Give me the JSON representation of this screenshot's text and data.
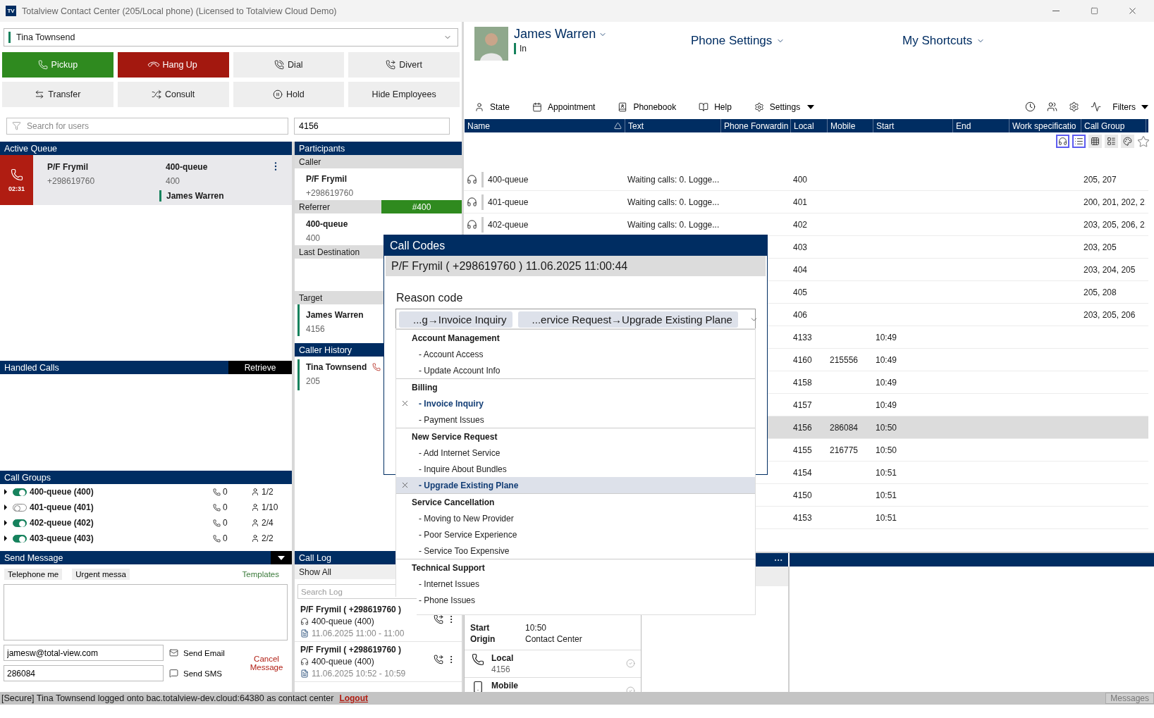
{
  "window": {
    "logo": "TV",
    "title": "Totalview Contact Center (205/Local phone) (Licensed to Totalview Cloud Demo)"
  },
  "user_select": {
    "value": "Tina Townsend"
  },
  "call_buttons": [
    {
      "label": "Pickup",
      "kind": "pickup"
    },
    {
      "label": "Hang Up",
      "kind": "hangup"
    },
    {
      "label": "Dial",
      "kind": "dial"
    },
    {
      "label": "Divert",
      "kind": "divert"
    },
    {
      "label": "Transfer",
      "kind": "transfer"
    },
    {
      "label": "Consult",
      "kind": "consult"
    },
    {
      "label": "Hold",
      "kind": "hold"
    },
    {
      "label": "Hide Employees",
      "kind": "plain"
    }
  ],
  "user_search": {
    "placeholder": "Search for users"
  },
  "number_field": {
    "value": "4156"
  },
  "active_queue": {
    "title": "Active Queue",
    "call": {
      "timer": "02:31",
      "caller": "P/F Frymil",
      "number": "+298619760",
      "queue": "400-queue",
      "queue_number": "400",
      "agent": "James Warren"
    }
  },
  "handled_calls": {
    "title": "Handled Calls",
    "action": "Retrieve"
  },
  "call_groups": {
    "title": "Call Groups",
    "rows": [
      {
        "name": "400-queue (400)",
        "on": true,
        "calls": "0",
        "agents": "1/2"
      },
      {
        "name": "401-queue (401)",
        "on": false,
        "calls": "0",
        "agents": "1/10"
      },
      {
        "name": "402-queue (402)",
        "on": true,
        "calls": "0",
        "agents": "2/4"
      },
      {
        "name": "403-queue (403)",
        "on": true,
        "calls": "0",
        "agents": "2/2"
      }
    ]
  },
  "send_message": {
    "title": "Send Message",
    "templates": [
      "Telephone me",
      "Urgent messa"
    ],
    "templates_link": "Templates",
    "email": "jamesw@total-view.com",
    "sms": "286084",
    "send_email": "Send Email",
    "send_sms": "Send SMS",
    "cancel": "Cancel Message"
  },
  "participants": {
    "title": "Participants",
    "sections": [
      {
        "label": "Caller",
        "name": "P/F Frymil",
        "number": "+298619760",
        "marker": false
      },
      {
        "label": "Referrer",
        "badge": "#400",
        "name": "400-queue",
        "number": "400",
        "marker": false
      },
      {
        "label": "Last Destination",
        "marker": false
      },
      {
        "label": "Target",
        "name": "James Warren",
        "number": "4156",
        "marker": true
      }
    ]
  },
  "caller_history": {
    "title": "Caller History",
    "entries": [
      {
        "name": "Tina Townsend",
        "number": "205"
      }
    ]
  },
  "call_log": {
    "title": "Call Log",
    "filter": "Show All",
    "search_placeholder": "Search Log",
    "entries": [
      {
        "caller": "P/F Frymil ( +298619760 )",
        "queue": "400-queue (400)",
        "time": "11.06.2025 11:00 - 11:00"
      },
      {
        "caller": "P/F Frymil ( +298619760 )",
        "queue": "400-queue (400)",
        "time": "11.06.2025 10:52 - 10:59"
      }
    ]
  },
  "profile": {
    "name": "James Warren",
    "status": "In"
  },
  "top_menus": [
    "Phone Settings",
    "My Shortcuts"
  ],
  "toolbar": {
    "items": [
      {
        "label": "State",
        "kind": "state"
      },
      {
        "label": "Appointment",
        "kind": "appointment"
      },
      {
        "label": "Phonebook",
        "kind": "phonebook"
      },
      {
        "label": "Help",
        "kind": "help"
      },
      {
        "label": "Settings",
        "kind": "settings"
      }
    ],
    "filters": "Filters"
  },
  "view_toggles": [
    {
      "kind": "headset",
      "selected": true
    },
    {
      "kind": "list",
      "selected": true
    },
    {
      "kind": "grid",
      "selected": false
    },
    {
      "kind": "cards",
      "selected": false
    },
    {
      "kind": "colors",
      "selected": false
    }
  ],
  "table": {
    "columns": [
      "Name",
      "Text",
      "Phone Forwardin",
      "Local",
      "Mobile",
      "Start",
      "End",
      "Work specificatio",
      "Call Group"
    ],
    "rows": [
      {
        "name": "400-queue",
        "text": "Waiting calls: 0. Logge...",
        "local": "400",
        "call_group": "205, 207",
        "selected": false
      },
      {
        "name": "401-queue",
        "text": "Waiting calls: 0. Logge...",
        "local": "401",
        "call_group": "200, 201, 202, 2.",
        "selected": false
      },
      {
        "name": "402-queue",
        "text": "Waiting calls: 0. Logge...",
        "local": "402",
        "call_group": "203, 205, 206, 2.",
        "selected": false
      },
      {
        "local": "403",
        "call_group": "203, 205",
        "selected": false
      },
      {
        "local": "404",
        "call_group": "203, 204, 205",
        "selected": false
      },
      {
        "local": "405",
        "call_group": "205, 208",
        "selected": false
      },
      {
        "local": "406",
        "call_group": "203, 205, 206",
        "selected": false
      },
      {
        "local": "4133",
        "start": "10:49",
        "selected": false
      },
      {
        "local": "4160",
        "mobile": "215556",
        "start": "10:49",
        "selected": false
      },
      {
        "local": "4158",
        "start": "10:49",
        "selected": false
      },
      {
        "local": "4157",
        "start": "10:49",
        "selected": false
      },
      {
        "local": "4156",
        "mobile": "286084",
        "start": "10:50",
        "selected": true
      },
      {
        "local": "4155",
        "mobile": "216775",
        "start": "10:50",
        "selected": false
      },
      {
        "local": "4154",
        "start": "10:51",
        "selected": false
      },
      {
        "local": "4150",
        "start": "10:51",
        "selected": false
      },
      {
        "local": "4153",
        "start": "10:51",
        "selected": false
      }
    ]
  },
  "details": {
    "fields": [
      {
        "label": "Start",
        "value": "10:50"
      },
      {
        "label": "Origin",
        "value": "Contact Center"
      }
    ],
    "phones": [
      {
        "label": "Local",
        "number": "4156",
        "kind": "desk"
      },
      {
        "label": "Mobile",
        "kind": "mobile"
      }
    ]
  },
  "status_bar": {
    "text": "[Secure] Tina Townsend logged onto bac.totalview-dev.cloud:64380 as contact center",
    "link": "Logout",
    "messages": "Messages"
  },
  "call_codes": {
    "title": "Call Codes",
    "subtitle": "P/F Frymil ( +298619760 ) 11.06.2025 11:00:44",
    "label": "Reason code",
    "chips": [
      "...g→Invoice Inquiry",
      "...ervice Request→Upgrade Existing Plane"
    ],
    "groups": [
      {
        "name": "Account Management",
        "options": [
          {
            "label": "- Account Access",
            "checked": false,
            "highlighted": false
          },
          {
            "label": "- Update Account Info",
            "checked": false,
            "highlighted": false
          }
        ]
      },
      {
        "name": "Billing",
        "options": [
          {
            "label": "- Invoice Inquiry",
            "checked": true,
            "highlighted": false
          },
          {
            "label": "- Payment Issues",
            "checked": false,
            "highlighted": false
          }
        ]
      },
      {
        "name": "New Service Request",
        "options": [
          {
            "label": "- Add Internet Service",
            "checked": false,
            "highlighted": false
          },
          {
            "label": "- Inquire About Bundles",
            "checked": false,
            "highlighted": false
          },
          {
            "label": "- Upgrade Existing Plane",
            "checked": true,
            "highlighted": true
          }
        ]
      },
      {
        "name": "Service Cancellation",
        "options": [
          {
            "label": "- Moving to New Provider",
            "checked": false,
            "highlighted": false
          },
          {
            "label": "- Poor Service Experience",
            "checked": false,
            "highlighted": false
          },
          {
            "label": "- Service Too Expensive",
            "checked": false,
            "highlighted": false
          }
        ]
      },
      {
        "name": "Technical Support",
        "options": [
          {
            "label": "- Internet Issues",
            "checked": false,
            "highlighted": false
          },
          {
            "label": "- Phone Issues",
            "checked": false,
            "highlighted": false
          }
        ]
      }
    ]
  }
}
